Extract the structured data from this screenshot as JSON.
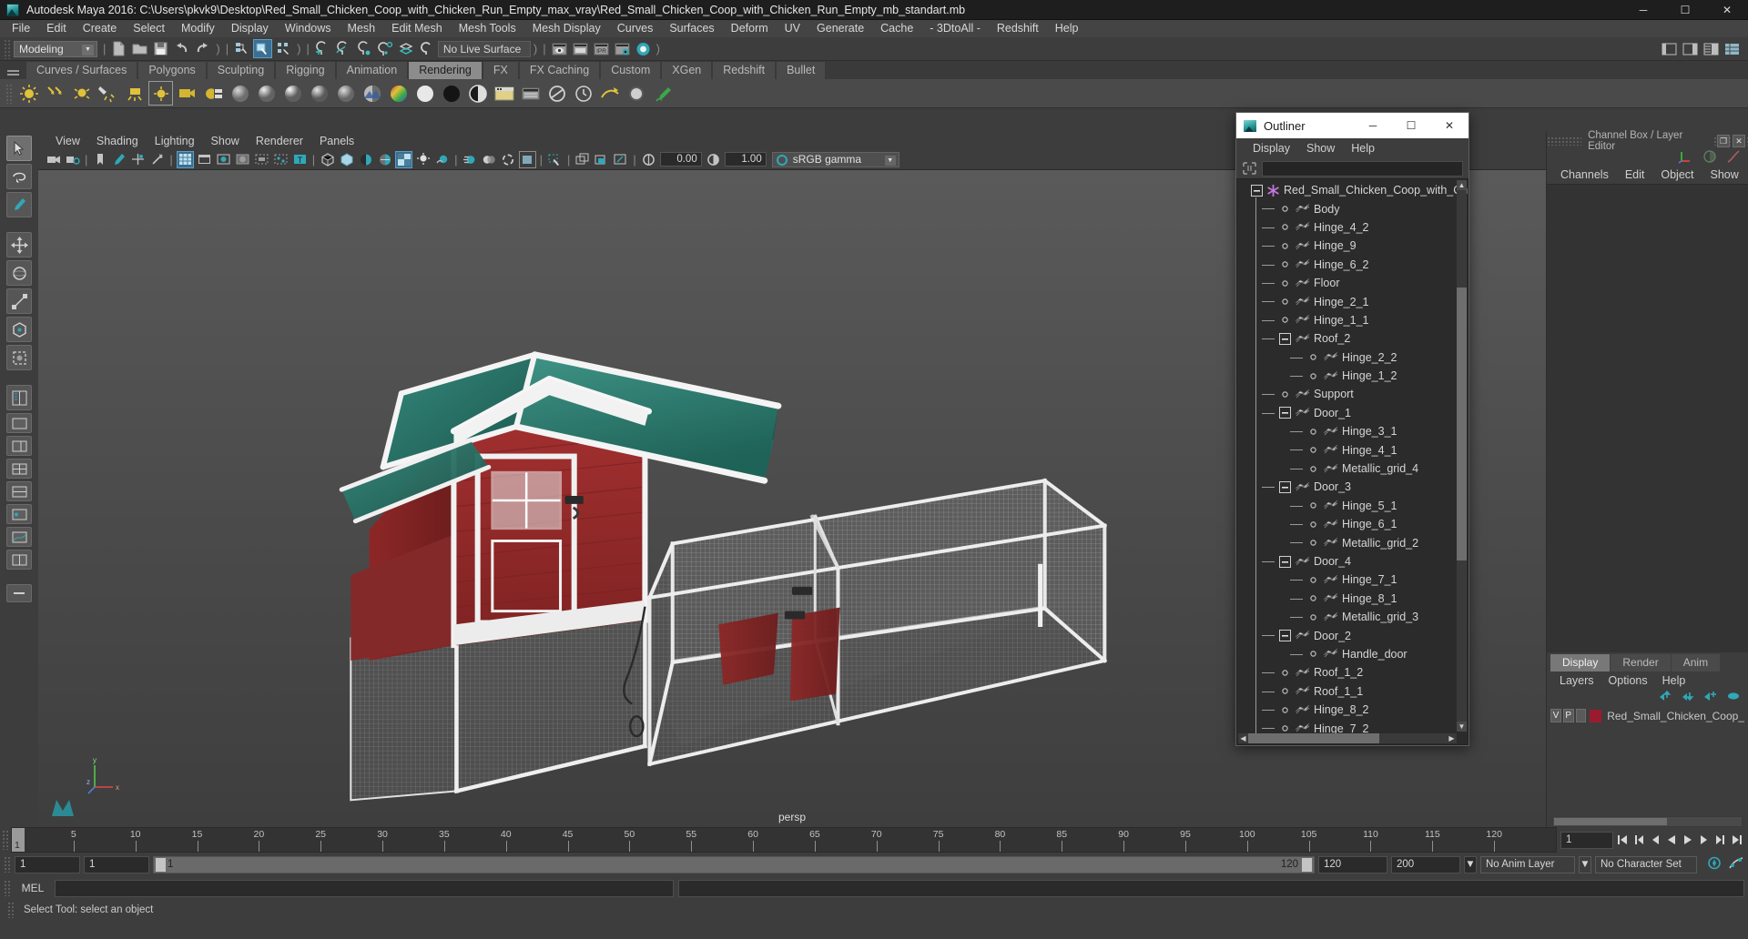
{
  "window": {
    "title": "Autodesk Maya 2016: C:\\Users\\pkvk9\\Desktop\\Red_Small_Chicken_Coop_with_Chicken_Run_Empty_max_vray\\Red_Small_Chicken_Coop_with_Chicken_Run_Empty_mb_standart.mb",
    "minimize": "─",
    "maximize": "☐",
    "close": "✕"
  },
  "menubar": [
    "File",
    "Edit",
    "Create",
    "Select",
    "Modify",
    "Display",
    "Windows",
    "Mesh",
    "Edit Mesh",
    "Mesh Tools",
    "Mesh Display",
    "Curves",
    "Surfaces",
    "Deform",
    "UV",
    "Generate",
    "Cache",
    "- 3DtoAll -",
    "Redshift",
    "Help"
  ],
  "statusbar": {
    "mode": "Modeling",
    "mode_arrow": "▼",
    "live_surface": "No Live Surface",
    "icons": [
      "new-scene-icon",
      "open-scene-icon",
      "save-scene-icon",
      "undo-icon",
      "redo-icon",
      "select-by-hierarchy-icon",
      "select-by-object-icon",
      "select-by-component-icon",
      "snap-to-grid-icon",
      "snap-to-curve-icon",
      "snap-to-point-icon",
      "snap-to-projected-center-icon",
      "snap-to-view-plane-icon",
      "make-live-icon",
      "render-view-icon",
      "render-region-icon",
      "ipr-render-icon",
      "render-settings-icon",
      "hypershade-icon"
    ],
    "right_icons": [
      "show-hide-ui-icon",
      "sidebar-toggle-icon",
      "attribute-editor-icon",
      "channel-box-icon"
    ]
  },
  "shelf": {
    "tabs": [
      "Curves / Surfaces",
      "Polygons",
      "Sculpting",
      "Rigging",
      "Animation",
      "Rendering",
      "FX",
      "FX Caching",
      "Custom",
      "XGen",
      "Redshift",
      "Bullet"
    ],
    "active_tab": "Rendering",
    "icons": [
      "ambient-light-icon",
      "directional-light-icon",
      "point-light-icon",
      "spot-light-icon",
      "area-light-icon",
      "volume-light-icon",
      "camera-icon",
      "image-plane-icon",
      "lambert-material-icon",
      "blinn-material-icon",
      "phong-material-icon",
      "phong-e-material-icon",
      "anisotropic-material-icon",
      "layered-shader-icon",
      "ramp-shader-icon",
      "surface-shader-icon",
      "use-background-icon",
      "shading-map-icon",
      "render-view-icon",
      "render-settings-icon",
      "batch-render-icon",
      "ipr-icon",
      "hardware-render-icon",
      "toon-shader-icon",
      "paint-effects-icon"
    ]
  },
  "toolbox": [
    "select-tool-icon",
    "lasso-select-tool-icon",
    "paint-select-tool-icon",
    "move-tool-icon",
    "rotate-tool-icon",
    "scale-tool-icon",
    "universal-manipulator-icon",
    "soft-modification-tool-icon",
    "last-tool-icon",
    "outliner-layout-icon",
    "persp-layout-icon",
    "persp-outliner-layout-icon",
    "four-view-layout-icon",
    "two-pane-stacked-layout-icon",
    "hypershade-layout-icon",
    "persp-graph-layout-icon",
    "two-pane-side-layout-icon",
    "minimize-layout-icon"
  ],
  "viewport": {
    "menus": [
      "View",
      "Shading",
      "Lighting",
      "Show",
      "Renderer",
      "Panels"
    ],
    "toolbar_icons": [
      "select-camera-icon",
      "camera-attributes-icon",
      "bookmarks-icon",
      "image-plane-icon",
      "two-sided-lighting-icon",
      "grid-toggle-icon",
      "film-gate-icon",
      "resolution-gate-icon",
      "gate-mask-icon",
      "film-origin-icon",
      "wireframe-on-shaded-icon",
      "texture-border-icon",
      "xray-icon",
      "xray-joints-icon",
      "shaded-icon",
      "smooth-shade-icon",
      "flat-shade-icon",
      "wireframe-icon",
      "bounding-box-icon",
      "hardware-texturing-icon",
      "lighting-icon",
      "shadows-icon",
      "ao-icon",
      "motion-blur-icon",
      "multisample-icon",
      "isolate-select-icon",
      "grid-icon",
      "grid-2-icon",
      "snapshot-icon",
      "exposure-icon",
      "gamma-icon"
    ],
    "exposure_value": "0.00",
    "gamma_value": "1.00",
    "color_management": "sRGB gamma",
    "color_management_arrow": "▼",
    "camera_label": "persp",
    "axis_labels": {
      "x": "x",
      "y": "y",
      "z": "z"
    }
  },
  "outliner": {
    "title": "Outliner",
    "window_buttons": {
      "minimize": "─",
      "maximize": "☐",
      "close": "✕"
    },
    "menus": [
      "Display",
      "Show",
      "Help"
    ],
    "search_placeholder": "",
    "search_value": "",
    "filter_icon": "search-filter-icon",
    "items": [
      {
        "label": "Red_Small_Chicken_Coop_with_Ch",
        "depth": 0,
        "expander": "minus",
        "icon": "transform-star-icon"
      },
      {
        "label": "Body",
        "depth": 1,
        "expander": "leaf",
        "icon": "mesh-icon"
      },
      {
        "label": "Hinge_4_2",
        "depth": 1,
        "expander": "leaf",
        "icon": "mesh-icon"
      },
      {
        "label": "Hinge_9",
        "depth": 1,
        "expander": "leaf",
        "icon": "mesh-icon"
      },
      {
        "label": "Hinge_6_2",
        "depth": 1,
        "expander": "leaf",
        "icon": "mesh-icon"
      },
      {
        "label": "Floor",
        "depth": 1,
        "expander": "leaf",
        "icon": "mesh-icon"
      },
      {
        "label": "Hinge_2_1",
        "depth": 1,
        "expander": "leaf",
        "icon": "mesh-icon"
      },
      {
        "label": "Hinge_1_1",
        "depth": 1,
        "expander": "leaf",
        "icon": "mesh-icon"
      },
      {
        "label": "Roof_2",
        "depth": 1,
        "expander": "minus",
        "icon": "mesh-icon"
      },
      {
        "label": "Hinge_2_2",
        "depth": 2,
        "expander": "leaf",
        "icon": "mesh-icon"
      },
      {
        "label": "Hinge_1_2",
        "depth": 2,
        "expander": "leaf",
        "icon": "mesh-icon"
      },
      {
        "label": "Support",
        "depth": 1,
        "expander": "leaf",
        "icon": "mesh-icon"
      },
      {
        "label": "Door_1",
        "depth": 1,
        "expander": "minus",
        "icon": "mesh-icon"
      },
      {
        "label": "Hinge_3_1",
        "depth": 2,
        "expander": "leaf",
        "icon": "mesh-icon"
      },
      {
        "label": "Hinge_4_1",
        "depth": 2,
        "expander": "leaf",
        "icon": "mesh-icon"
      },
      {
        "label": "Metallic_grid_4",
        "depth": 2,
        "expander": "leaf",
        "icon": "mesh-icon"
      },
      {
        "label": "Door_3",
        "depth": 1,
        "expander": "minus",
        "icon": "mesh-icon"
      },
      {
        "label": "Hinge_5_1",
        "depth": 2,
        "expander": "leaf",
        "icon": "mesh-icon"
      },
      {
        "label": "Hinge_6_1",
        "depth": 2,
        "expander": "leaf",
        "icon": "mesh-icon"
      },
      {
        "label": "Metallic_grid_2",
        "depth": 2,
        "expander": "leaf",
        "icon": "mesh-icon"
      },
      {
        "label": "Door_4",
        "depth": 1,
        "expander": "minus",
        "icon": "mesh-icon"
      },
      {
        "label": "Hinge_7_1",
        "depth": 2,
        "expander": "leaf",
        "icon": "mesh-icon"
      },
      {
        "label": "Hinge_8_1",
        "depth": 2,
        "expander": "leaf",
        "icon": "mesh-icon"
      },
      {
        "label": "Metallic_grid_3",
        "depth": 2,
        "expander": "leaf",
        "icon": "mesh-icon"
      },
      {
        "label": "Door_2",
        "depth": 1,
        "expander": "minus",
        "icon": "mesh-icon"
      },
      {
        "label": "Handle_door",
        "depth": 2,
        "expander": "leaf",
        "icon": "mesh-icon"
      },
      {
        "label": "Roof_1_2",
        "depth": 1,
        "expander": "leaf",
        "icon": "mesh-icon"
      },
      {
        "label": "Roof_1_1",
        "depth": 1,
        "expander": "leaf",
        "icon": "mesh-icon"
      },
      {
        "label": "Hinge_8_2",
        "depth": 1,
        "expander": "leaf",
        "icon": "mesh-icon"
      },
      {
        "label": "Hinge_7_2",
        "depth": 1,
        "expander": "leaf",
        "icon": "mesh-icon"
      }
    ]
  },
  "rightpanel": {
    "title": "Channel Box / Layer Editor",
    "undock": "❐",
    "close": "✕",
    "channel_menus": [
      "Channels",
      "Edit",
      "Object",
      "Show"
    ],
    "layer_tabs": [
      "Display",
      "Render",
      "Anim"
    ],
    "layer_active_tab": "Display",
    "layer_menus": [
      "Layers",
      "Options",
      "Help"
    ],
    "layer_icons": [
      "move-layer-up-icon",
      "move-layer-down-icon",
      "new-layer-icon",
      "new-layer-from-selected-icon"
    ],
    "layers": [
      {
        "visible": "V",
        "playback": "P",
        "state": "",
        "color": "#9b1b2e",
        "name": "Red_Small_Chicken_Coop_"
      }
    ]
  },
  "timeline": {
    "current_frame": "1",
    "labels": [
      "5",
      "10",
      "15",
      "20",
      "25",
      "30",
      "35",
      "40",
      "45",
      "50",
      "55",
      "60",
      "65",
      "70",
      "75",
      "80",
      "85",
      "90",
      "95",
      "100",
      "105",
      "110",
      "115",
      "120"
    ],
    "start_field": "1",
    "end_field": "1",
    "range_start": "1",
    "range_end": "120",
    "anim_start": "120",
    "anim_end": "200",
    "anim_layer": "No Anim Layer",
    "anim_layer_arrow": "▼",
    "character_set": "No Character Set",
    "playback_icons": [
      "go-to-start-icon",
      "step-back-key-icon",
      "step-back-frame-icon",
      "play-backwards-icon",
      "play-forwards-icon",
      "step-forward-frame-icon",
      "step-forward-key-icon",
      "go-to-end-icon"
    ],
    "right_icons": [
      "auto-keyframe-icon",
      "animation-preferences-icon"
    ]
  },
  "command_line": {
    "language": "MEL",
    "input_value": "",
    "output_value": ""
  },
  "statusline": {
    "text": "Select Tool: select an object"
  },
  "colors": {
    "accent": "#3c6e8f",
    "teal": "#2fa8b8",
    "shelf_active": "#8c8c8c",
    "panel_bg": "#3d3d3d",
    "tree_bg": "#2b2b2b",
    "layer_swatch": "#9b1b2e",
    "roof_green": "#2c7a6e",
    "body_red": "#9b2b2b",
    "frame_white": "#e8e8e8"
  }
}
